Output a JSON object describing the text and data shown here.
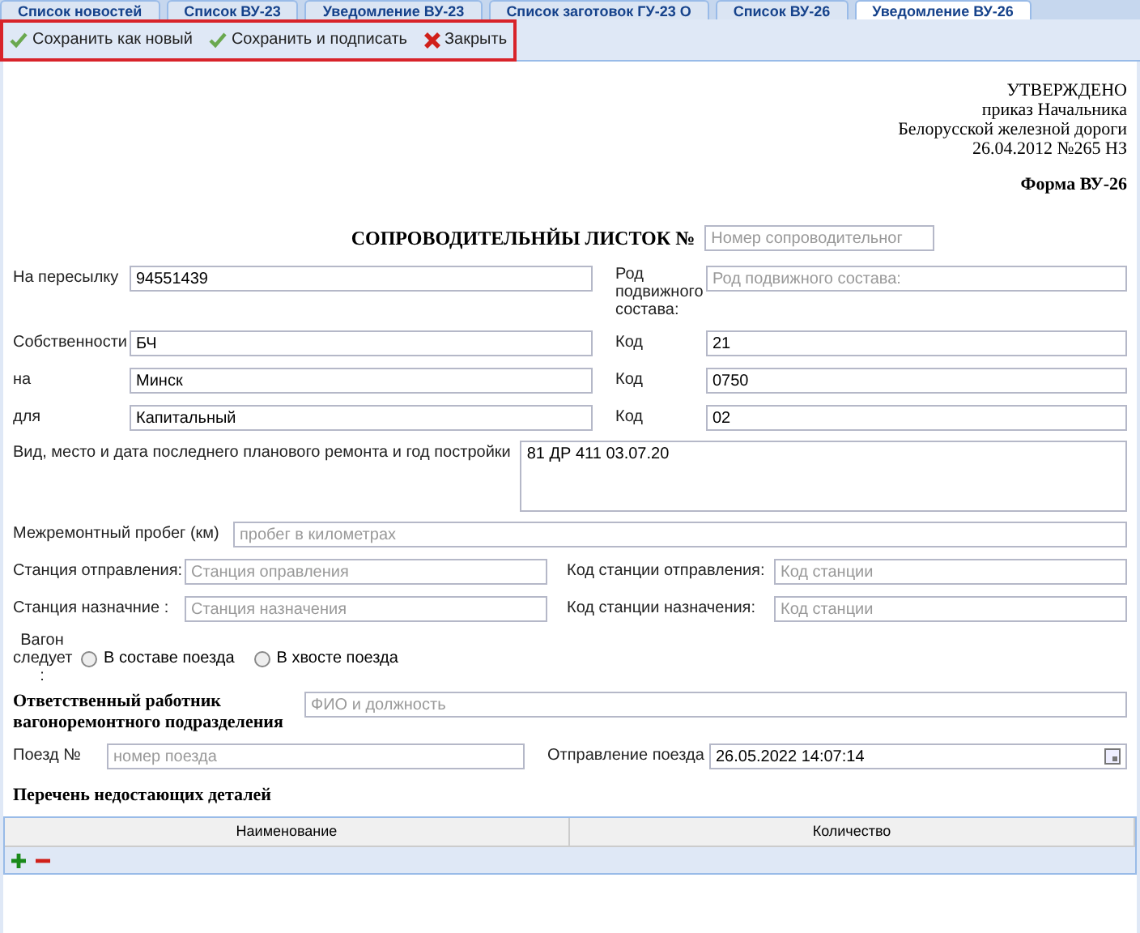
{
  "tabs": [
    {
      "label": "Список новостей",
      "selected": false
    },
    {
      "label": "Список ВУ-23",
      "selected": false
    },
    {
      "label": "Уведомление ВУ-23",
      "selected": false
    },
    {
      "label": "Список заготовок ГУ-23 О",
      "selected": false
    },
    {
      "label": "Список ВУ-26",
      "selected": false
    },
    {
      "label": "Уведомление ВУ-26",
      "selected": true
    }
  ],
  "toolbar": [
    {
      "label": "Сохранить как новый",
      "kind": "check"
    },
    {
      "label": "Сохранить и подписать",
      "kind": "check"
    },
    {
      "label": "Закрыть",
      "kind": "close"
    }
  ],
  "approval": [
    "УТВЕРЖДЕНО",
    "приказ Начальника",
    "Белорусской железной дороги",
    "26.04.2012 №265 НЗ"
  ],
  "form_name": "Форма ВУ-26",
  "title": "СОПРОВОДИТЕЛЬНЙЫ ЛИСТОК №",
  "number_field": {
    "placeholder": "Номер сопроводительног"
  },
  "top_rows": [
    {
      "left": {
        "label": "На пересылку",
        "value": "94551439"
      },
      "right": {
        "label": "Род подвижного состава:",
        "placeholder": "Род подвижного состава:"
      }
    },
    {
      "left": {
        "label": "Собственности",
        "value": "БЧ"
      },
      "right": {
        "label": "Код",
        "value": "21"
      }
    },
    {
      "left": {
        "label": "на",
        "value": "Минск"
      },
      "right": {
        "label": "Код",
        "value": "0750"
      }
    },
    {
      "left": {
        "label": "для",
        "value": "Капитальный"
      },
      "right": {
        "label": "Код",
        "value": "02"
      }
    }
  ],
  "repair": {
    "label": "Вид, место и дата последнего планового ремонта и год постройки",
    "value": "81 ДР 411 03.07.20"
  },
  "mileage": {
    "label": "Межремонтный пробег (км)",
    "placeholder": "пробег в километрах"
  },
  "station_rows": [
    {
      "left": {
        "label": "Станция отправления:",
        "placeholder": "Станция оправления"
      },
      "right": {
        "label": "Код станции отправления:",
        "placeholder": "Код станции"
      }
    },
    {
      "left": {
        "label": "Станция назначние :",
        "placeholder": "Станция назначения"
      },
      "right": {
        "label": "Код станции назначения:",
        "placeholder": "Код станции"
      }
    }
  ],
  "wagon": {
    "label": "Вагон следует :",
    "options": [
      {
        "label": "В составе поезда",
        "selected": false
      },
      {
        "label": "В хвосте поезда",
        "selected": false
      }
    ]
  },
  "responsible": {
    "label": "Ответственный работник вагоноремонтного подразделения",
    "placeholder": "ФИО и должность"
  },
  "train": {
    "label": "Поезд №",
    "placeholder": "номер поезда"
  },
  "departure": {
    "label": "Отправление поезда",
    "value": "26.05.2022 14:07:14"
  },
  "parts": {
    "title": "Перечень недостающих деталей",
    "columns": [
      "Наименование",
      "Количество"
    ]
  }
}
